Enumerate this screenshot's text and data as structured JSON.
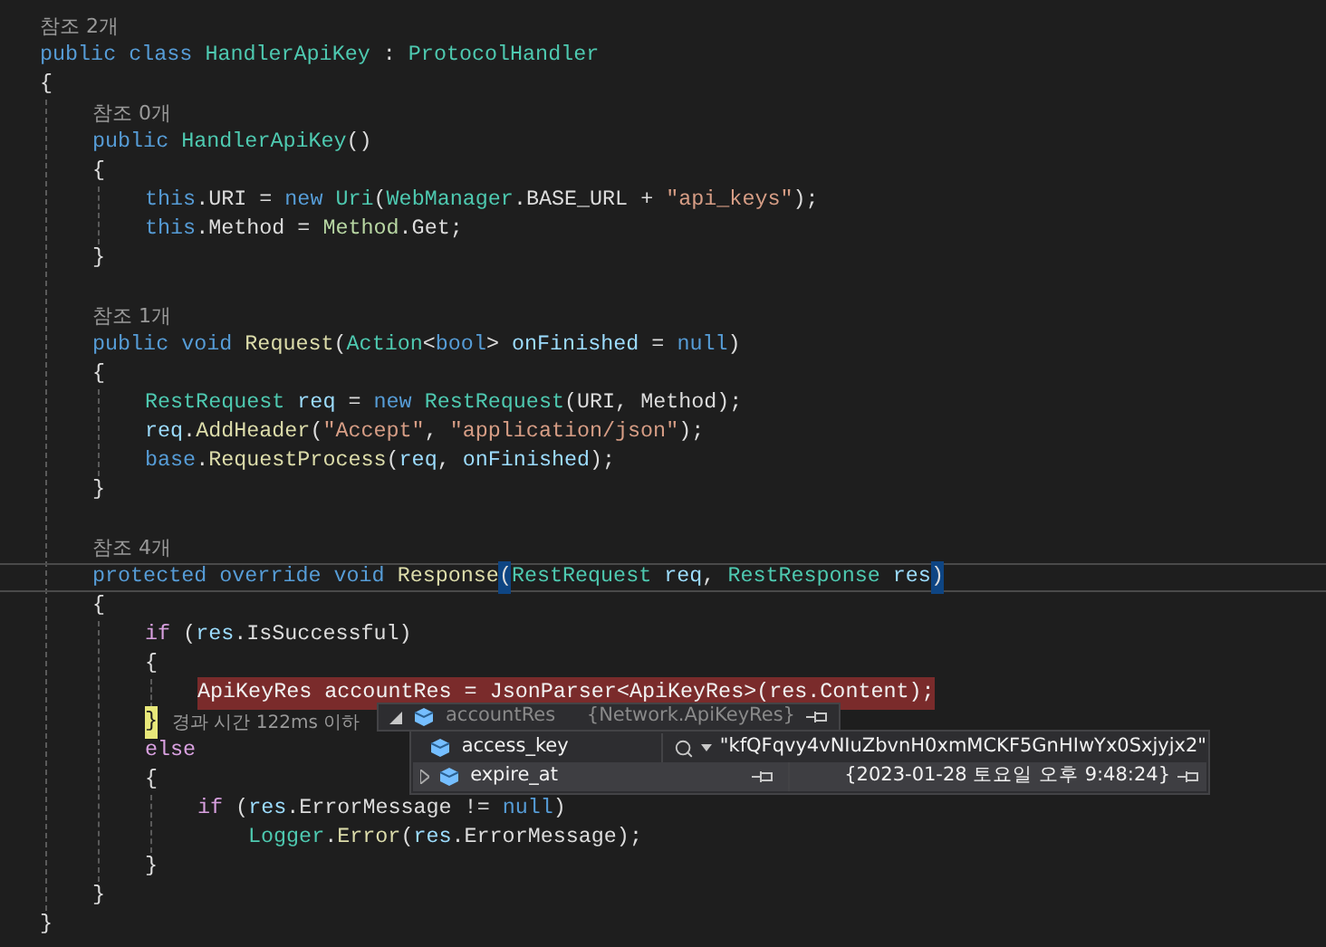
{
  "editor": {
    "lines": [
      {
        "kind": "lens",
        "text": "참조 2개"
      },
      {
        "kind": "code",
        "tokens": [
          {
            "t": "public class ",
            "kind": "kw"
          },
          {
            "t": "HandlerApiKey",
            "kind": "type"
          },
          {
            "t": " : ",
            "kind": "plain"
          },
          {
            "t": "ProtocolHandler",
            "kind": "type"
          }
        ]
      },
      {
        "kind": "code",
        "tokens": [
          {
            "t": "{",
            "kind": "plain"
          }
        ]
      },
      {
        "kind": "block",
        "children": [
          {
            "kind": "lens",
            "text": "참조 0개"
          },
          {
            "kind": "code",
            "tokens": [
              {
                "t": "public ",
                "kind": "kw"
              },
              {
                "t": "HandlerApiKey",
                "kind": "type"
              },
              {
                "t": "()",
                "kind": "plain"
              }
            ]
          },
          {
            "kind": "code",
            "tokens": [
              {
                "t": "{",
                "kind": "plain"
              }
            ]
          },
          {
            "kind": "block",
            "children": [
              {
                "kind": "code",
                "tokens": [
                  {
                    "t": "this",
                    "kind": "kw"
                  },
                  {
                    "t": ".URI = ",
                    "kind": "plain"
                  },
                  {
                    "t": "new ",
                    "kind": "kw"
                  },
                  {
                    "t": "Uri",
                    "kind": "type"
                  },
                  {
                    "t": "(",
                    "kind": "plain"
                  },
                  {
                    "t": "WebManager",
                    "kind": "type"
                  },
                  {
                    "t": ".BASE_URL + ",
                    "kind": "plain"
                  },
                  {
                    "t": "\"api_keys\"",
                    "kind": "str"
                  },
                  {
                    "t": ");",
                    "kind": "plain"
                  }
                ]
              },
              {
                "kind": "code",
                "tokens": [
                  {
                    "t": "this",
                    "kind": "kw"
                  },
                  {
                    "t": ".Method = ",
                    "kind": "plain"
                  },
                  {
                    "t": "Method",
                    "kind": "enum"
                  },
                  {
                    "t": ".Get;",
                    "kind": "plain"
                  }
                ]
              }
            ]
          },
          {
            "kind": "code",
            "tokens": [
              {
                "t": "}",
                "kind": "plain"
              }
            ]
          },
          {
            "kind": "blank"
          },
          {
            "kind": "lens",
            "text": "참조 1개"
          },
          {
            "kind": "code",
            "tokens": [
              {
                "t": "public void ",
                "kind": "kw"
              },
              {
                "t": "Request",
                "kind": "fn"
              },
              {
                "t": "(",
                "kind": "plain"
              },
              {
                "t": "Action",
                "kind": "type"
              },
              {
                "t": "<",
                "kind": "plain"
              },
              {
                "t": "bool",
                "kind": "kw"
              },
              {
                "t": "> ",
                "kind": "plain"
              },
              {
                "t": "onFinished",
                "kind": "var"
              },
              {
                "t": " = ",
                "kind": "plain"
              },
              {
                "t": "null",
                "kind": "kw"
              },
              {
                "t": ")",
                "kind": "plain"
              }
            ]
          },
          {
            "kind": "code",
            "tokens": [
              {
                "t": "{",
                "kind": "plain"
              }
            ]
          },
          {
            "kind": "block",
            "children": [
              {
                "kind": "code",
                "tokens": [
                  {
                    "t": "RestRequest ",
                    "kind": "type"
                  },
                  {
                    "t": "req",
                    "kind": "var"
                  },
                  {
                    "t": " = ",
                    "kind": "plain"
                  },
                  {
                    "t": "new ",
                    "kind": "kw"
                  },
                  {
                    "t": "RestRequest",
                    "kind": "type"
                  },
                  {
                    "t": "(URI, Method);",
                    "kind": "plain"
                  }
                ]
              },
              {
                "kind": "code",
                "tokens": [
                  {
                    "t": "req",
                    "kind": "var"
                  },
                  {
                    "t": ".",
                    "kind": "plain"
                  },
                  {
                    "t": "AddHeader",
                    "kind": "fn"
                  },
                  {
                    "t": "(",
                    "kind": "plain"
                  },
                  {
                    "t": "\"Accept\"",
                    "kind": "str"
                  },
                  {
                    "t": ", ",
                    "kind": "plain"
                  },
                  {
                    "t": "\"application/json\"",
                    "kind": "str"
                  },
                  {
                    "t": ");",
                    "kind": "plain"
                  }
                ]
              },
              {
                "kind": "code",
                "tokens": [
                  {
                    "t": "base",
                    "kind": "kw"
                  },
                  {
                    "t": ".",
                    "kind": "plain"
                  },
                  {
                    "t": "RequestProcess",
                    "kind": "fn"
                  },
                  {
                    "t": "(",
                    "kind": "plain"
                  },
                  {
                    "t": "req",
                    "kind": "var"
                  },
                  {
                    "t": ", ",
                    "kind": "plain"
                  },
                  {
                    "t": "onFinished",
                    "kind": "var"
                  },
                  {
                    "t": ");",
                    "kind": "plain"
                  }
                ]
              }
            ]
          },
          {
            "kind": "code",
            "tokens": [
              {
                "t": "}",
                "kind": "plain"
              }
            ]
          },
          {
            "kind": "blank"
          },
          {
            "kind": "lens",
            "text": "참조 4개"
          },
          {
            "kind": "current",
            "tokens": [
              {
                "t": "protected override void ",
                "kind": "kw"
              },
              {
                "t": "Response",
                "kind": "fn"
              },
              {
                "t": "(",
                "kind": "match"
              },
              {
                "t": "RestRequest ",
                "kind": "type"
              },
              {
                "t": "req",
                "kind": "var"
              },
              {
                "t": ", ",
                "kind": "plain"
              },
              {
                "t": "RestResponse ",
                "kind": "type"
              },
              {
                "t": "res",
                "kind": "var"
              },
              {
                "t": ")",
                "kind": "match"
              }
            ]
          },
          {
            "kind": "code",
            "tokens": [
              {
                "t": "{",
                "kind": "plain"
              }
            ]
          },
          {
            "kind": "block",
            "children": [
              {
                "kind": "code",
                "tokens": [
                  {
                    "t": "if",
                    "kind": "ctrl"
                  },
                  {
                    "t": " (",
                    "kind": "plain"
                  },
                  {
                    "t": "res",
                    "kind": "var"
                  },
                  {
                    "t": ".IsSuccessful)",
                    "kind": "plain"
                  }
                ]
              },
              {
                "kind": "code",
                "tokens": [
                  {
                    "t": "{",
                    "kind": "plain"
                  }
                ]
              },
              {
                "kind": "block",
                "children": [
                  {
                    "kind": "highlighted",
                    "text": "ApiKeyRes accountRes = JsonParser<ApiKeyRes>(res.Content);"
                  }
                ]
              },
              {
                "kind": "code",
                "tokens": [
                  {
                    "t": "}",
                    "kind": "brace"
                  }
                ],
                "hint": "경과 시간 122ms 이하"
              },
              {
                "kind": "code",
                "tokens": [
                  {
                    "t": "else",
                    "kind": "ctrl"
                  }
                ]
              },
              {
                "kind": "code",
                "tokens": [
                  {
                    "t": "{",
                    "kind": "plain"
                  }
                ]
              },
              {
                "kind": "block",
                "children": [
                  {
                    "kind": "code",
                    "tokens": [
                      {
                        "t": "if",
                        "kind": "ctrl"
                      },
                      {
                        "t": " (",
                        "kind": "plain"
                      },
                      {
                        "t": "res",
                        "kind": "var"
                      },
                      {
                        "t": ".ErrorMessage != ",
                        "kind": "plain"
                      },
                      {
                        "t": "null",
                        "kind": "kw"
                      },
                      {
                        "t": ")",
                        "kind": "plain"
                      }
                    ]
                  },
                  {
                    "kind": "indent",
                    "children": [
                      {
                        "kind": "code",
                        "tokens": [
                          {
                            "t": "Logger",
                            "kind": "type"
                          },
                          {
                            "t": ".",
                            "kind": "plain"
                          },
                          {
                            "t": "Error",
                            "kind": "fn"
                          },
                          {
                            "t": "(",
                            "kind": "plain"
                          },
                          {
                            "t": "res",
                            "kind": "var"
                          },
                          {
                            "t": ".ErrorMessage);",
                            "kind": "plain"
                          }
                        ]
                      }
                    ]
                  }
                ]
              },
              {
                "kind": "code",
                "tokens": [
                  {
                    "t": "}",
                    "kind": "plain"
                  }
                ]
              }
            ]
          },
          {
            "kind": "code",
            "tokens": [
              {
                "t": "}",
                "kind": "plain"
              }
            ]
          }
        ]
      },
      {
        "kind": "code",
        "tokens": [
          {
            "t": "}",
            "kind": "plain"
          }
        ]
      }
    ]
  },
  "datatip": {
    "name": "accountRes",
    "value": "{Network.ApiKeyRes}",
    "expanded": true,
    "children": [
      {
        "name": "access_key",
        "value": "\"kfQFqvy4vNIuZbvnH0xmMCKF5GnHIwYx0Sxjyjx2\"",
        "expandable": false,
        "selected": false
      },
      {
        "name": "expire_at",
        "value": "{2023-01-28 토요일 오후 9:48:24}",
        "expandable": true,
        "selected": true
      }
    ]
  }
}
